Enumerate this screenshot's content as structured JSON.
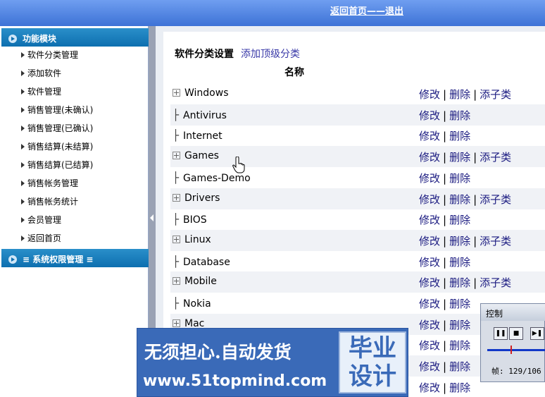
{
  "header": {
    "nav_text": "返回首页——退出"
  },
  "sidebar": {
    "section1": "功能模块",
    "items": [
      {
        "label": "软件分类管理"
      },
      {
        "label": "添加软件"
      },
      {
        "label": "软件管理"
      },
      {
        "label": "销售管理(未确认)"
      },
      {
        "label": "销售管理(已确认)"
      },
      {
        "label": "销售结算(未结算)"
      },
      {
        "label": "销售结算(已结算)"
      },
      {
        "label": "销售帐务管理"
      },
      {
        "label": "销售帐务统计"
      },
      {
        "label": "会员管理"
      },
      {
        "label": "返回首页"
      }
    ],
    "section2": "≡ 系统权限管理 ≡"
  },
  "main": {
    "title": "软件分类设置",
    "add_top_label": "添加顶级分类",
    "column_name": "名称",
    "actions": {
      "edit": "修改",
      "delete": "删除",
      "add_child": "添子类"
    },
    "rows": [
      {
        "name": "Windows",
        "expand": true,
        "child": true
      },
      {
        "name": "Antivirus",
        "expand": false,
        "child": false
      },
      {
        "name": "Internet",
        "expand": false,
        "child": false
      },
      {
        "name": "Games",
        "expand": true,
        "child": true
      },
      {
        "name": "Games-Demo",
        "expand": false,
        "child": false
      },
      {
        "name": "Drivers",
        "expand": true,
        "child": true
      },
      {
        "name": "BIOS",
        "expand": false,
        "child": false
      },
      {
        "name": "Linux",
        "expand": true,
        "child": true
      },
      {
        "name": "Database",
        "expand": false,
        "child": false
      },
      {
        "name": "Mobile",
        "expand": true,
        "child": true
      },
      {
        "name": "Nokia",
        "expand": false,
        "child": false
      },
      {
        "name": "Mac",
        "expand": true,
        "child": false
      },
      {
        "name": "",
        "expand": false,
        "child": false
      },
      {
        "name": "",
        "expand": false,
        "child": false
      },
      {
        "name": "",
        "expand": false,
        "child": false
      }
    ]
  },
  "watermark": {
    "line1": "无须担心.自动发货",
    "line2": "www.51topmind.com",
    "box": "毕业设计"
  },
  "control": {
    "title": "控制",
    "frame": "帧: 129/106"
  }
}
